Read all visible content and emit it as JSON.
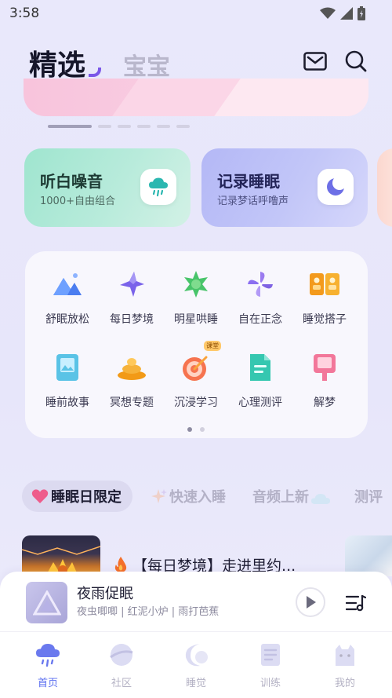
{
  "status_bar": {
    "time": "3:58",
    "wifi_icon": "wifi-icon",
    "signal_icon": "signal-icon",
    "battery_icon": "battery-icon"
  },
  "header": {
    "tabs": [
      {
        "label": "精选",
        "active": true
      },
      {
        "label": "宝宝",
        "active": false
      }
    ],
    "mail_icon": "mail-icon",
    "search_icon": "search-icon"
  },
  "banner": {
    "pages": 6,
    "active_page": 1
  },
  "feature_cards": [
    {
      "title": "听白噪音",
      "subtitle": "1000+自由组合",
      "icon": "rain-cloud-icon",
      "color": "#9fe5cf"
    },
    {
      "title": "记录睡眠",
      "subtitle": "记录梦话呼噜声",
      "icon": "moon-icon",
      "color": "#b4b8f6"
    }
  ],
  "grid": {
    "items": [
      {
        "label": "舒眠放松",
        "icon": "mountain-icon"
      },
      {
        "label": "每日梦境",
        "icon": "sparkle-star-icon"
      },
      {
        "label": "明星哄睡",
        "icon": "green-star-icon"
      },
      {
        "label": "自在正念",
        "icon": "pinwheel-icon"
      },
      {
        "label": "睡觉搭子",
        "icon": "partner-cards-icon"
      },
      {
        "label": "睡前故事",
        "icon": "storybook-icon"
      },
      {
        "label": "冥想专题",
        "icon": "meditation-stones-icon"
      },
      {
        "label": "沉浸学习",
        "icon": "target-icon",
        "badge": "课堂"
      },
      {
        "label": "心理测评",
        "icon": "document-icon"
      },
      {
        "label": "解梦",
        "icon": "dream-sign-icon"
      }
    ],
    "page_count": 2,
    "active_page": 1
  },
  "category_tabs": [
    {
      "label": "睡眠日限定",
      "icon": "heart-icon",
      "active": true
    },
    {
      "label": "快速入睡",
      "icon": "sparkle-icon",
      "active": false
    },
    {
      "label": "音频上新",
      "icon": "cloud-icon",
      "active": false
    },
    {
      "label": "测评",
      "active": false
    }
  ],
  "content": {
    "title": "【每日梦境】走进里约...",
    "fire_icon": "fire-icon"
  },
  "player": {
    "title": "夜雨促眠",
    "subtitle": "夜虫唧唧 | 红泥小炉 | 雨打芭蕉",
    "play_icon": "play-icon",
    "playlist_icon": "playlist-icon"
  },
  "bottom_nav": [
    {
      "label": "首页",
      "icon": "home-cloud-icon",
      "active": true
    },
    {
      "label": "社区",
      "icon": "planet-icon",
      "active": false
    },
    {
      "label": "睡觉",
      "icon": "moon-nav-icon",
      "active": false
    },
    {
      "label": "训练",
      "icon": "notebook-icon",
      "active": false
    },
    {
      "label": "我的",
      "icon": "cat-icon",
      "active": false
    }
  ],
  "colors": {
    "accent": "#7b57e8",
    "nav_active": "#5a6ef0",
    "background": "#e9e8fb"
  }
}
